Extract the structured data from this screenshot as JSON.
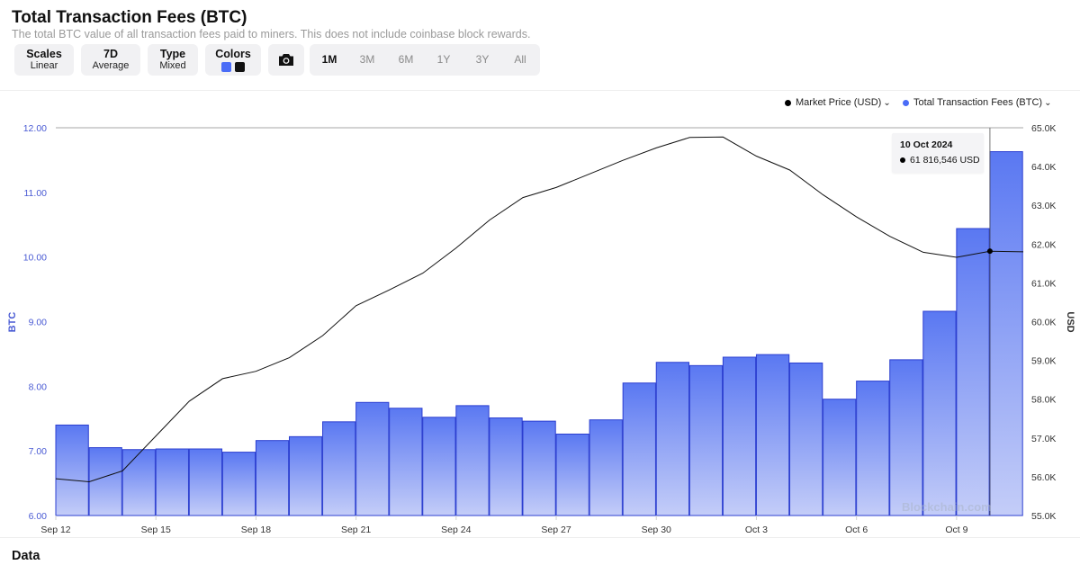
{
  "header": {
    "title": "Total Transaction Fees (BTC)",
    "subtitle": "The total BTC value of all transaction fees paid to miners. This does not include coinbase block rewards."
  },
  "controls": {
    "scales": {
      "label": "Scales",
      "value": "Linear"
    },
    "average": {
      "label": "7D",
      "value": "Average"
    },
    "type": {
      "label": "Type",
      "value": "Mixed"
    },
    "colors": {
      "label": "Colors",
      "swatch1": "#4a6cf7",
      "swatch2": "#111111"
    },
    "camera_icon": "camera-icon",
    "ranges": [
      "1M",
      "3M",
      "6M",
      "1Y",
      "3Y",
      "All"
    ],
    "active_range": "1M"
  },
  "legend": {
    "market_price": "Market Price (USD)",
    "fees": "Total Transaction Fees (BTC)"
  },
  "tooltip": {
    "date": "10 Oct 2024",
    "value": "61 816,546 USD"
  },
  "watermark": "Blockchain.com",
  "data_heading": "Data",
  "colors": {
    "bar_top": "#5a78f2",
    "bar_bottom": "#c4cdf8",
    "bar_stroke": "#2c3fd0",
    "line": "#111111",
    "left_axis": "#4a5bd4",
    "right_axis": "#333333"
  },
  "chart_data": {
    "type": "bar+line",
    "xlabel": "",
    "y_left_label": "BTC",
    "y_right_label": "USD",
    "y_left_range": [
      6.0,
      12.0
    ],
    "y_right_range": [
      55000,
      65000
    ],
    "y_left_ticks": [
      "6.00",
      "7.00",
      "8.00",
      "9.00",
      "10.00",
      "11.00",
      "12.00"
    ],
    "y_right_ticks": [
      "55.0K",
      "56.0K",
      "57.0K",
      "58.0K",
      "59.0K",
      "60.0K",
      "61.0K",
      "62.0K",
      "63.0K",
      "64.0K",
      "65.0K"
    ],
    "x_ticks": [
      "Sep 12",
      "Sep 15",
      "Sep 18",
      "Sep 21",
      "Sep 24",
      "Sep 27",
      "Sep 30",
      "Oct 3",
      "Oct 6",
      "Oct 9"
    ],
    "series": [
      {
        "name": "Total Transaction Fees (BTC)",
        "type": "bar",
        "axis": "left",
        "values": [
          7.4,
          7.05,
          7.02,
          7.03,
          7.03,
          6.98,
          7.16,
          7.22,
          7.45,
          7.75,
          7.66,
          7.52,
          7.7,
          7.51,
          7.46,
          7.26,
          7.48,
          8.05,
          8.37,
          8.32,
          8.45,
          8.49,
          8.36,
          7.8,
          8.08,
          8.41,
          9.16,
          10.44,
          11.63
        ]
      },
      {
        "name": "Market Price (USD)",
        "type": "line",
        "axis": "right",
        "values": [
          55950,
          55870,
          56150,
          57050,
          57950,
          58530,
          58720,
          59070,
          59640,
          60410,
          60820,
          61250,
          61900,
          62620,
          63200,
          63460,
          63810,
          64160,
          64480,
          64750,
          64760,
          64270,
          63910,
          63270,
          62700,
          62200,
          61790,
          61660,
          61817,
          61800
        ]
      }
    ]
  }
}
